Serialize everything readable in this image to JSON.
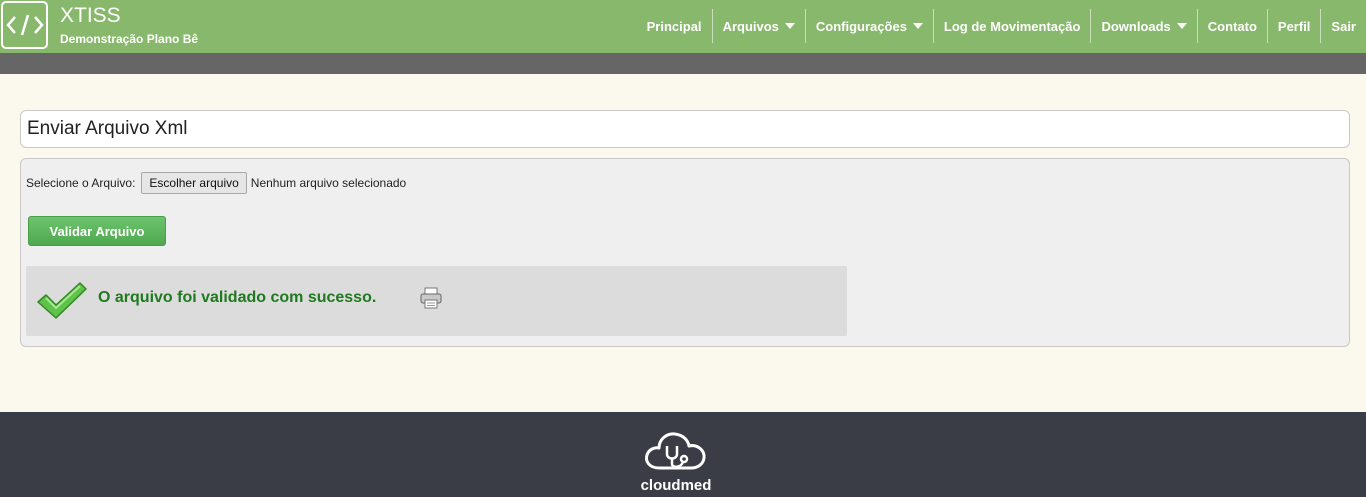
{
  "header": {
    "logo_icon": "code-brackets-icon",
    "title": "XTISS",
    "subtitle": "Demonstração Plano Bê",
    "nav": [
      {
        "label": "Principal",
        "dropdown": false
      },
      {
        "label": "Arquivos",
        "dropdown": true
      },
      {
        "label": "Configurações",
        "dropdown": true
      },
      {
        "label": "Log de Movimentação",
        "dropdown": false
      },
      {
        "label": "Downloads",
        "dropdown": true
      },
      {
        "label": "Contato",
        "dropdown": false
      },
      {
        "label": "Perfil",
        "dropdown": false
      },
      {
        "label": "Sair",
        "dropdown": false
      }
    ]
  },
  "page": {
    "title": "Enviar Arquivo Xml"
  },
  "upload": {
    "label": "Selecione o Arquivo:",
    "choose_button": "Escolher arquivo",
    "status": "Nenhum arquivo selecionado",
    "validate_button": "Validar Arquivo"
  },
  "result": {
    "icon": "checkmark-icon",
    "message": "O arquivo foi validado com sucesso.",
    "print_icon": "printer-icon"
  },
  "footer": {
    "brand": "cloudmed",
    "icon": "cloud-stethoscope-icon"
  },
  "colors": {
    "header_bg": "#88b86c",
    "subbar_bg": "#666667",
    "page_bg": "#fbf8ee",
    "success_green": "#1f7a1f",
    "button_green": "#5cb85c",
    "footer_bg": "#3a3d45"
  }
}
